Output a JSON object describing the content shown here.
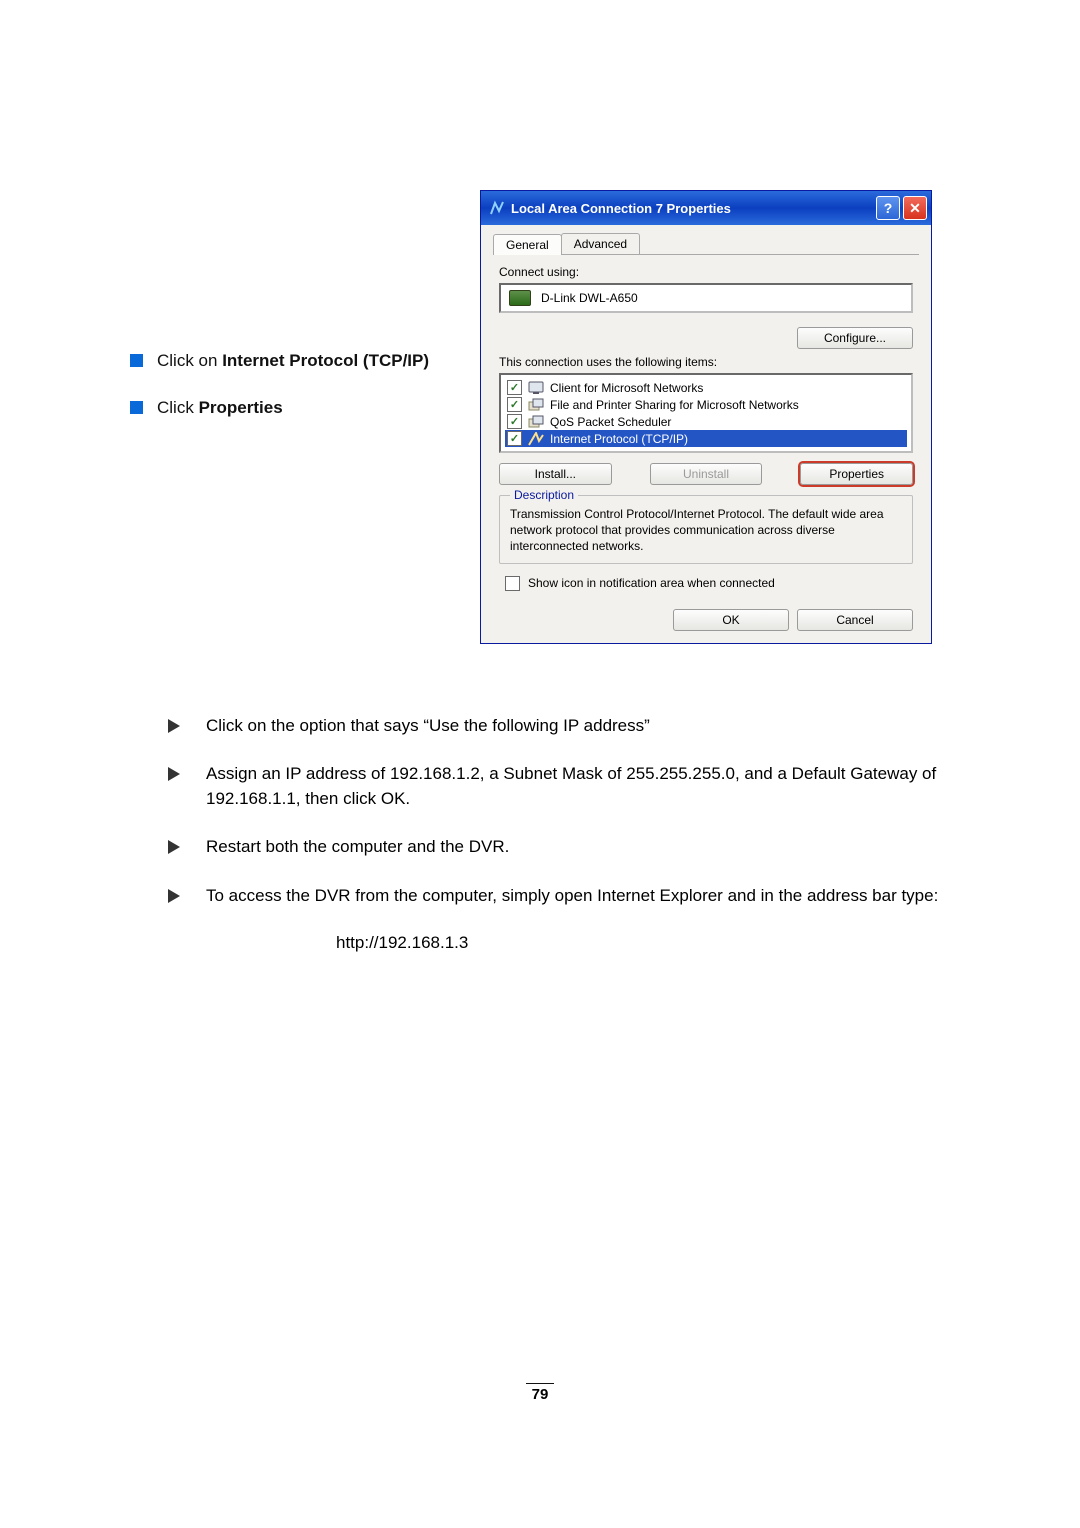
{
  "left_instructions": {
    "i1_pre": "Click on ",
    "i1_bold": "Internet Protocol (TCP/IP)",
    "i2_pre": "Click ",
    "i2_bold": "Properties"
  },
  "dialog": {
    "title": "Local Area Connection 7 Properties",
    "tabs": {
      "general": "General",
      "advanced": "Advanced"
    },
    "connect_using_label": "Connect using:",
    "adapter": "D-Link DWL-A650",
    "configure_btn": "Configure...",
    "items_label": "This connection uses the following items:",
    "items": [
      {
        "label": "Client for Microsoft Networks",
        "checked": true,
        "selected": false
      },
      {
        "label": "File and Printer Sharing for Microsoft Networks",
        "checked": true,
        "selected": false
      },
      {
        "label": "QoS Packet Scheduler",
        "checked": true,
        "selected": false
      },
      {
        "label": "Internet Protocol (TCP/IP)",
        "checked": true,
        "selected": true
      }
    ],
    "install_btn": "Install...",
    "uninstall_btn": "Uninstall",
    "properties_btn": "Properties",
    "description_legend": "Description",
    "description_text": "Transmission Control Protocol/Internet Protocol. The default wide area network protocol that provides communication across diverse interconnected networks.",
    "show_icon_label": "Show icon in notification area when connected",
    "ok_btn": "OK",
    "cancel_btn": "Cancel"
  },
  "bullets": {
    "b1": "Click on the option that says “Use the following IP address”",
    "b2": "Assign an IP address of 192.168.1.2, a Subnet Mask of 255.255.255.0, and a Default Gateway of 192.168.1.1, then click OK.",
    "b3": "Restart both the computer and the DVR.",
    "b4": "To access the DVR from the computer, simply open Internet Explorer and in the address bar type:",
    "url": "http://192.168.1.3"
  },
  "page_number": "79"
}
